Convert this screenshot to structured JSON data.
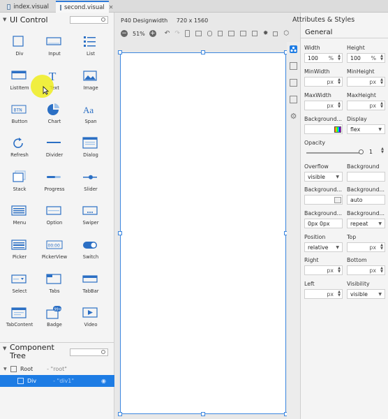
{
  "tabs": [
    {
      "label": "index.visual",
      "active": false
    },
    {
      "label": "second.visual",
      "active": true
    }
  ],
  "ui_control": {
    "title": "UI Control",
    "items": [
      {
        "label": "Div",
        "icon": "div-icon"
      },
      {
        "label": "Input",
        "icon": "input-icon"
      },
      {
        "label": "List",
        "icon": "list-icon"
      },
      {
        "label": "ListItem",
        "icon": "listitem-icon"
      },
      {
        "label": "Text",
        "icon": "text-icon"
      },
      {
        "label": "Image",
        "icon": "image-icon"
      },
      {
        "label": "Button",
        "icon": "button-icon"
      },
      {
        "label": "Chart",
        "icon": "chart-icon"
      },
      {
        "label": "Span",
        "icon": "span-icon"
      },
      {
        "label": "Refresh",
        "icon": "refresh-icon"
      },
      {
        "label": "Divider",
        "icon": "divider-icon"
      },
      {
        "label": "Dialog",
        "icon": "dialog-icon"
      },
      {
        "label": "Stack",
        "icon": "stack-icon"
      },
      {
        "label": "Progress",
        "icon": "progress-icon"
      },
      {
        "label": "Slider",
        "icon": "slider-icon"
      },
      {
        "label": "Menu",
        "icon": "menu-icon"
      },
      {
        "label": "Option",
        "icon": "option-icon"
      },
      {
        "label": "Swiper",
        "icon": "swiper-icon"
      },
      {
        "label": "Picker",
        "icon": "picker-icon"
      },
      {
        "label": "PickerView",
        "icon": "pickerview-icon"
      },
      {
        "label": "Switch",
        "icon": "switch-icon"
      },
      {
        "label": "Select",
        "icon": "select-icon"
      },
      {
        "label": "Tabs",
        "icon": "tabs-icon"
      },
      {
        "label": "TabBar",
        "icon": "tabbar-icon"
      },
      {
        "label": "TabContent",
        "icon": "tabcontent-icon"
      },
      {
        "label": "Badge",
        "icon": "badge-icon"
      },
      {
        "label": "Video",
        "icon": "video-icon"
      }
    ],
    "badge_text": "99+",
    "button_icon_text": "BTN",
    "span_icon_text": "Aa",
    "pickerview_icon_text": "00:00"
  },
  "component_tree": {
    "title": "Component Tree",
    "nodes": [
      {
        "name": "Root",
        "sub": "- \"root\"",
        "selected": false
      },
      {
        "name": "Div",
        "sub": "- \"div1\"",
        "selected": true
      }
    ]
  },
  "canvas": {
    "device": "P40 Designwidth",
    "size": "720 x 1560",
    "zoom": "51%"
  },
  "attributes": {
    "title": "Attributes & Styles",
    "section": "General",
    "width_label": "Width",
    "width_value": "100",
    "width_unit": "%",
    "height_label": "Height",
    "height_value": "100",
    "height_unit": "%",
    "minwidth_label": "MinWidth",
    "minwidth_unit": "px",
    "minheight_label": "MinHeight",
    "minheight_unit": "px",
    "maxwidth_label": "MaxWidth",
    "maxwidth_unit": "px",
    "maxheight_label": "MaxHeight",
    "maxheight_unit": "px",
    "background1_label": "Background...",
    "display_label": "Display",
    "display_value": "flex",
    "opacity_label": "Opacity",
    "opacity_value": "1",
    "overflow_label": "Overflow",
    "overflow_value": "visible",
    "background_label": "Background",
    "background2_label": "Background...",
    "background3_label": "Background...",
    "background3_value": "auto",
    "background4_label": "Background...",
    "background4_value": "0px 0px",
    "background5_label": "Background...",
    "background5_value": "repeat",
    "position_label": "Position",
    "position_value": "relative",
    "top_label": "Top",
    "top_unit": "px",
    "right_label": "Right",
    "right_unit": "px",
    "bottom_label": "Bottom",
    "bottom_unit": "px",
    "left_label": "Left",
    "left_unit": "px",
    "visibility_label": "Visibility",
    "visibility_value": "visible"
  },
  "colors": {
    "accent": "#1d7ce4",
    "artboard_border": "#3b86df",
    "cursor_highlight": "#eeec1e"
  }
}
